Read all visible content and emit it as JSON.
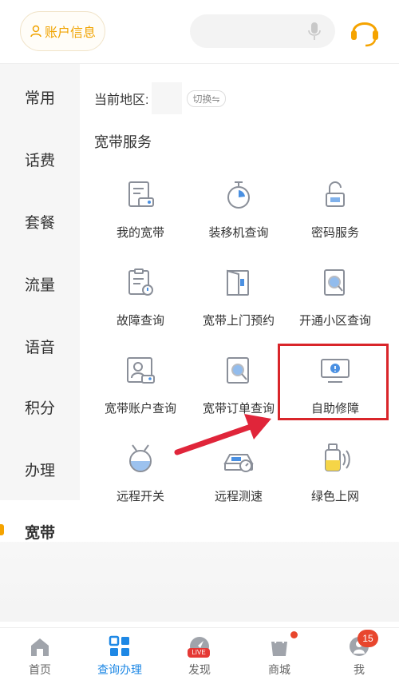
{
  "header": {
    "account_label": "账户信息",
    "icons": [
      "user-icon",
      "mic-icon",
      "headset-icon"
    ]
  },
  "sidebar": {
    "items": [
      {
        "label": "常用",
        "active": false
      },
      {
        "label": "话费",
        "active": false
      },
      {
        "label": "套餐",
        "active": false
      },
      {
        "label": "流量",
        "active": false
      },
      {
        "label": "语音",
        "active": false
      },
      {
        "label": "积分",
        "active": false
      },
      {
        "label": "办理",
        "active": false
      },
      {
        "label": "宽带",
        "active": true
      }
    ]
  },
  "content": {
    "region_label": "当前地区:",
    "switch_label": "切换⇋",
    "section_title": "宽带服务",
    "services": [
      {
        "label": "我的宽带",
        "icon": "broadband-doc-icon"
      },
      {
        "label": "装移机查询",
        "icon": "timer-icon"
      },
      {
        "label": "密码服务",
        "icon": "unlock-icon"
      },
      {
        "label": "故障查询",
        "icon": "fault-doc-icon"
      },
      {
        "label": "宽带上门预约",
        "icon": "door-icon"
      },
      {
        "label": "开通小区查询",
        "icon": "search-doc-icon"
      },
      {
        "label": "宽带账户查询",
        "icon": "account-card-icon"
      },
      {
        "label": "宽带订单查询",
        "icon": "order-search-icon"
      },
      {
        "label": "自助修障",
        "icon": "monitor-alert-icon"
      },
      {
        "label": "远程开关",
        "icon": "remote-switch-icon"
      },
      {
        "label": "远程测速",
        "icon": "speed-test-icon"
      },
      {
        "label": "绿色上网",
        "icon": "green-web-icon"
      }
    ]
  },
  "bottom_nav": {
    "items": [
      {
        "label": "首页",
        "icon": "home-icon",
        "active": false
      },
      {
        "label": "查询办理",
        "icon": "grid-icon",
        "active": true
      },
      {
        "label": "发现",
        "icon": "discover-icon",
        "active": false
      },
      {
        "label": "商城",
        "icon": "bag-icon",
        "active": false
      },
      {
        "label": "我",
        "icon": "me-icon",
        "active": false
      }
    ],
    "live_label": "LIVE",
    "badge_count": "15"
  },
  "colors": {
    "accent": "#f5a300",
    "active_nav": "#1e88e5",
    "highlight": "#d9252a",
    "icon_gray": "#8a8f99",
    "icon_blue": "#4a90e2"
  }
}
